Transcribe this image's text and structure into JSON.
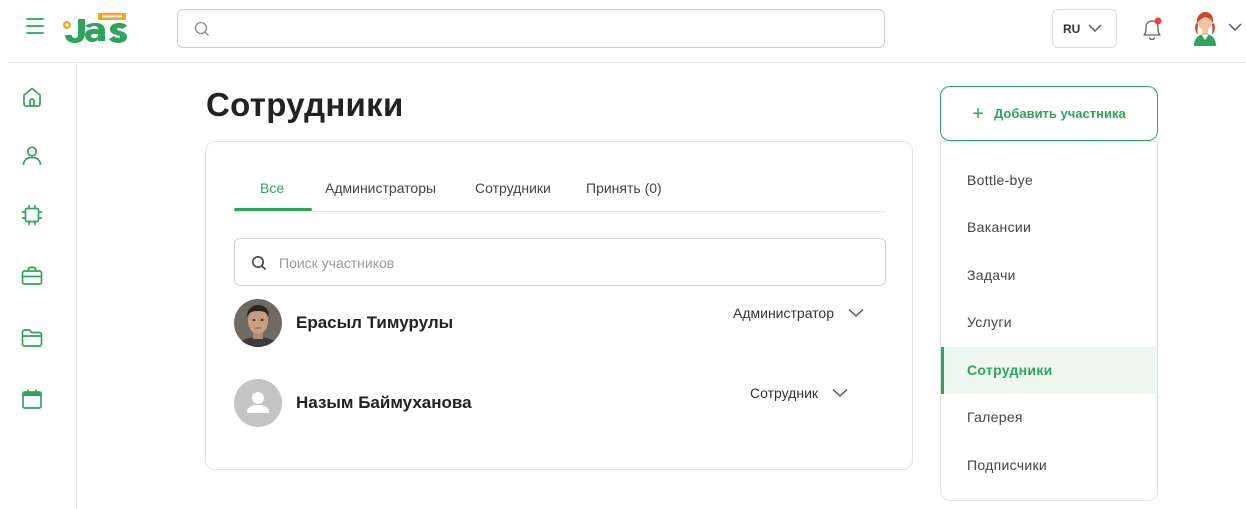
{
  "colors": {
    "accent": "#2ea55d",
    "accent_light": "#eef8f1",
    "border": "#e3e3e3",
    "logo_orange": "#f5a623"
  },
  "header": {
    "logo_text": "Jas",
    "search_placeholder": "",
    "language": "RU",
    "icons": [
      "menu-icon",
      "search-icon",
      "chevron-down-icon",
      "bell-icon",
      "user-avatar"
    ]
  },
  "left_nav": {
    "icons": [
      "home-icon",
      "user-icon",
      "chip-icon",
      "briefcase-icon",
      "folder-icon",
      "calendar-icon"
    ]
  },
  "main": {
    "title": "Сотрудники",
    "tabs": [
      {
        "label": "Все",
        "active": true
      },
      {
        "label": "Администраторы",
        "active": false
      },
      {
        "label": "Сотрудники",
        "active": false
      },
      {
        "label": "Принять (0)",
        "active": false
      }
    ],
    "member_search_placeholder": "Поиск участников",
    "members": [
      {
        "name": "Ерасыл Тимурулы",
        "role": "Администратор",
        "avatar": "photo"
      },
      {
        "name": "Назым Баймуханова",
        "role": "Сотрудник",
        "avatar": "placeholder"
      }
    ]
  },
  "right_panel": {
    "add_button_label": "Добавить участника",
    "menu": [
      {
        "label": "Bottle-bye",
        "active": false
      },
      {
        "label": "Вакансии",
        "active": false
      },
      {
        "label": "Задачи",
        "active": false
      },
      {
        "label": "Услуги",
        "active": false
      },
      {
        "label": "Сотрудники",
        "active": true
      },
      {
        "label": "Галерея",
        "active": false
      },
      {
        "label": "Подписчики",
        "active": false
      }
    ]
  }
}
